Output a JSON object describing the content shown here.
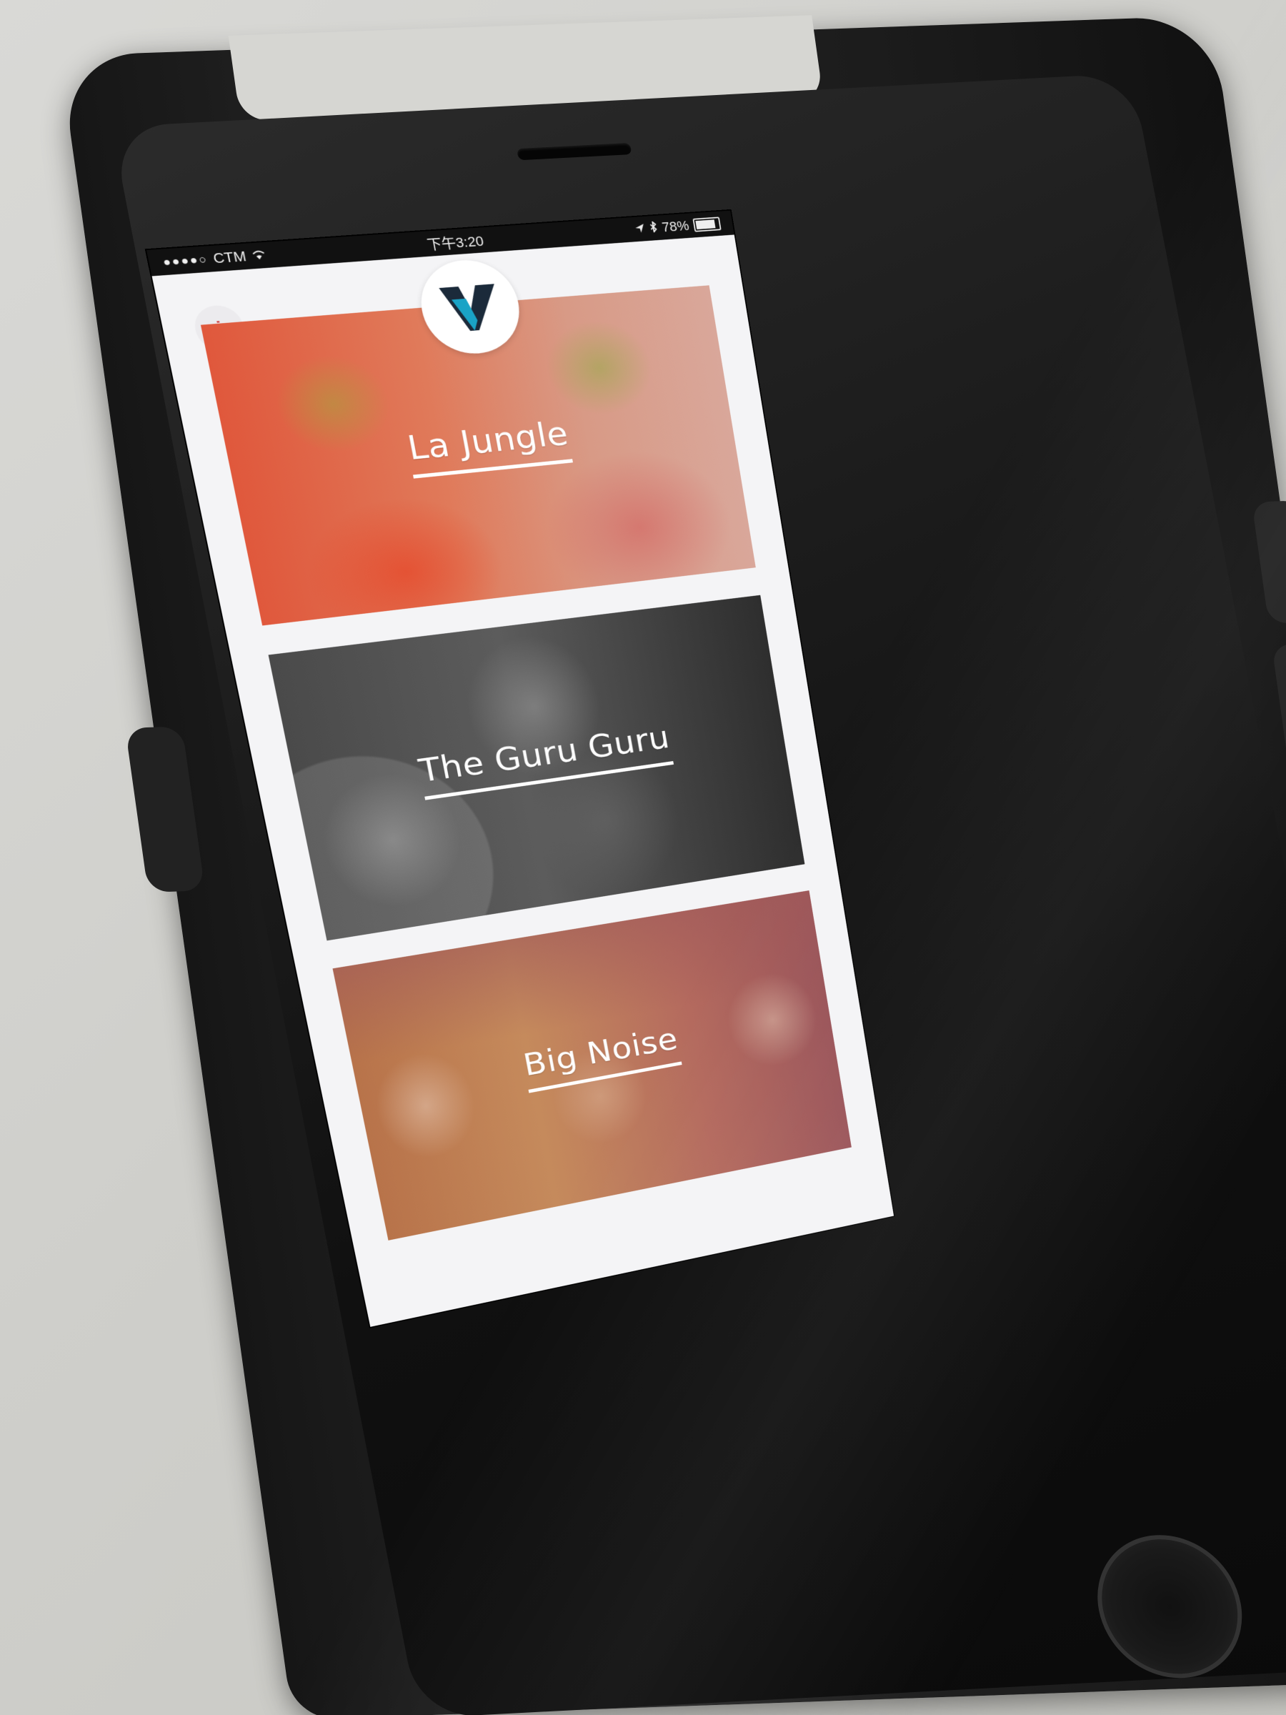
{
  "status_bar": {
    "carrier": "CTM",
    "signal_dots": "●●●●○",
    "time": "下午3:20",
    "battery": "78%"
  },
  "header": {
    "info_button": "i",
    "logo": "V",
    "logo_colors": {
      "dark": "#1b2a3a",
      "accent": "#1aa3c6"
    }
  },
  "cards": [
    {
      "title": "La Jungle"
    },
    {
      "title": "The Guru Guru"
    },
    {
      "title": "Big Noise"
    }
  ]
}
